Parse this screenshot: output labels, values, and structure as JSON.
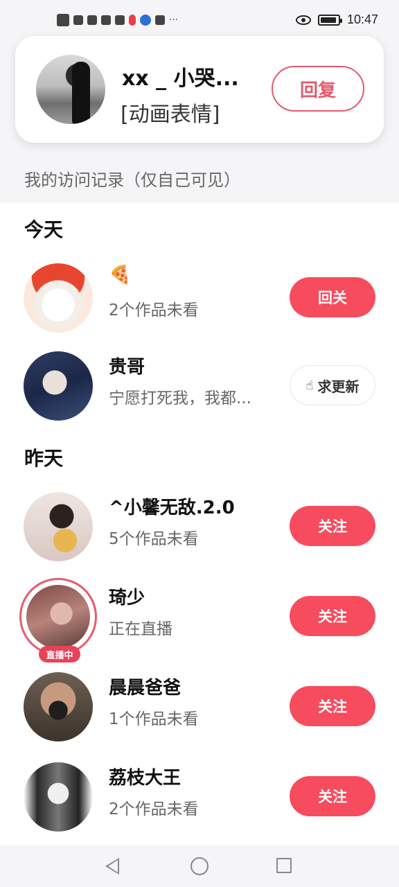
{
  "status_bar": {
    "time": "10:47",
    "more_indicator": "···"
  },
  "message_card": {
    "name": "xx _ 小哭...",
    "subtitle": "[动画表情]",
    "reply_label": "回复"
  },
  "visit_label": "我的访问记录（仅自己可见）",
  "sections": {
    "today": "今天",
    "yesterday": "昨天"
  },
  "rows": [
    {
      "name": "🍕",
      "subtitle": "2个作品未看",
      "button": "回关"
    },
    {
      "name": "贵哥",
      "subtitle": "宁愿打死我，我都...",
      "button": "求更新"
    },
    {
      "name": "^小馨无敌.2.0",
      "subtitle": "5个作品未看",
      "button": "关注"
    },
    {
      "name": "琦少",
      "subtitle": "正在直播",
      "button": "关注",
      "live_badge": "直播中"
    },
    {
      "name": "晨晨爸爸",
      "subtitle": "1个作品未看",
      "button": "关注"
    },
    {
      "name": "荔枝大王",
      "subtitle": "2个作品未看",
      "button": "关注"
    }
  ],
  "colors": {
    "accent": "#f74b5e",
    "reply_border": "#e25a6c",
    "background_gray": "#f5f5f7"
  },
  "icons": {
    "update_button_icon": "hand-pointer-icon"
  }
}
